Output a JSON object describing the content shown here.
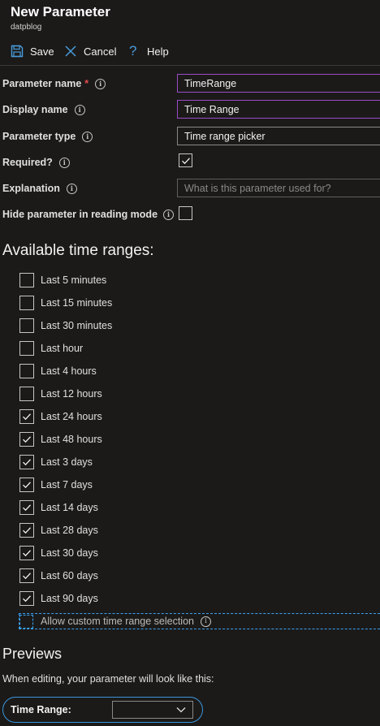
{
  "header": {
    "title": "New Parameter",
    "subtitle": "datpblog"
  },
  "toolbar": {
    "save_label": "Save",
    "cancel_label": "Cancel",
    "help_label": "Help"
  },
  "form": {
    "name_label": "Parameter name",
    "name_required": "*",
    "name_value": "TimeRange",
    "display_label": "Display name",
    "display_value": "Time Range",
    "type_label": "Parameter type",
    "type_value": "Time range picker",
    "required_label": "Required?",
    "required_checked": true,
    "explanation_label": "Explanation",
    "explanation_placeholder": "What is this parameter used for?",
    "hide_label": "Hide parameter in reading mode",
    "hide_checked": false
  },
  "ranges": {
    "title": "Available time ranges:",
    "items": [
      {
        "label": "Last 5 minutes",
        "checked": false
      },
      {
        "label": "Last 15 minutes",
        "checked": false
      },
      {
        "label": "Last 30 minutes",
        "checked": false
      },
      {
        "label": "Last hour",
        "checked": false
      },
      {
        "label": "Last 4 hours",
        "checked": false
      },
      {
        "label": "Last 12 hours",
        "checked": false
      },
      {
        "label": "Last 24 hours",
        "checked": true
      },
      {
        "label": "Last 48 hours",
        "checked": true
      },
      {
        "label": "Last 3 days",
        "checked": true
      },
      {
        "label": "Last 7 days",
        "checked": true
      },
      {
        "label": "Last 14 days",
        "checked": true
      },
      {
        "label": "Last 28 days",
        "checked": true
      },
      {
        "label": "Last 30 days",
        "checked": true
      },
      {
        "label": "Last 60 days",
        "checked": true
      },
      {
        "label": "Last 90 days",
        "checked": true
      }
    ],
    "custom_label": "Allow custom time range selection",
    "custom_checked": false
  },
  "previews": {
    "title": "Previews",
    "note": "When editing, your parameter will look like this:",
    "field_label": "Time Range:",
    "field_value": ""
  },
  "icons": {
    "save": "save-icon",
    "cancel": "close-icon",
    "help": "help-icon",
    "info": "info-icon",
    "check": "checkmark-icon",
    "dropdown": "chevron-down-icon"
  },
  "colors": {
    "background": "#1b1a19",
    "accent": "#3a96dd",
    "focus": "#9b4cc5",
    "required": "#e34b4b"
  }
}
